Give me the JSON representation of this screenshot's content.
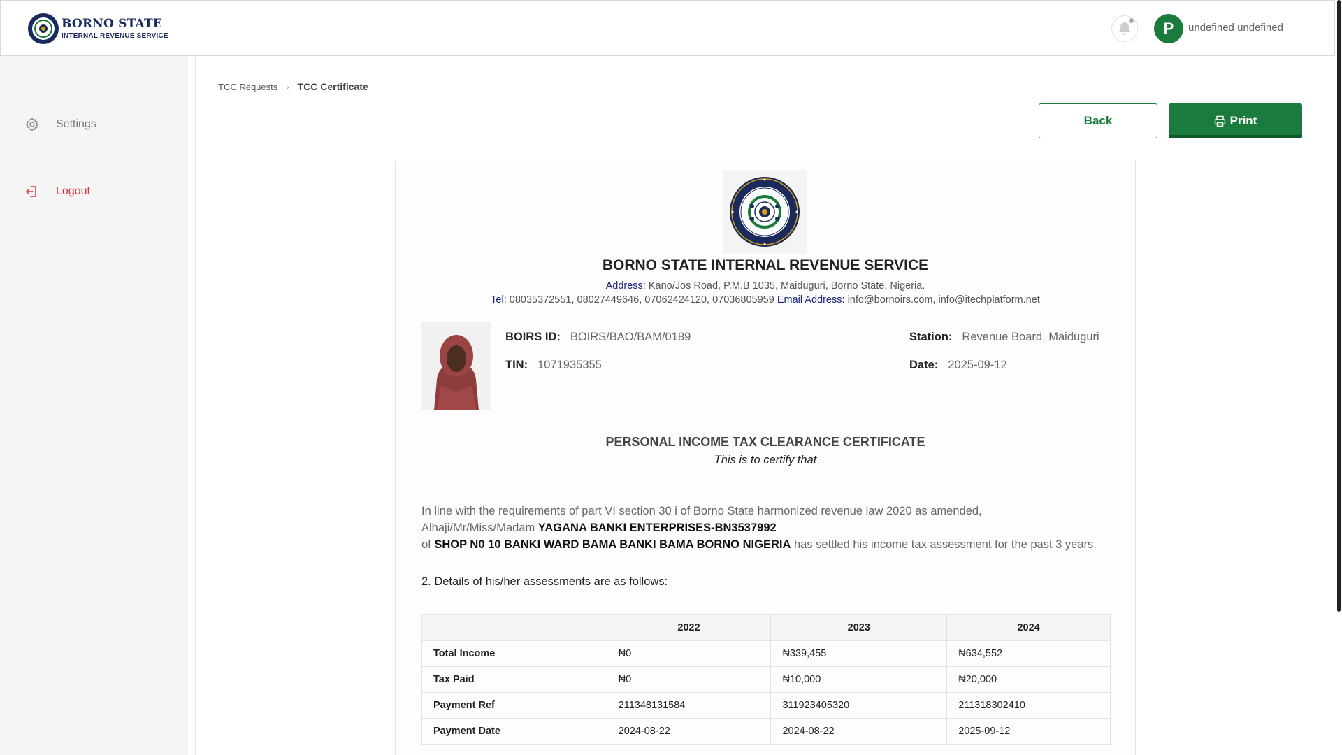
{
  "header": {
    "logo_title": "BORNO STATE",
    "logo_subtitle": "INTERNAL REVENUE SERVICE",
    "avatar_initial": "P",
    "user_name": "undefined undefined"
  },
  "sidebar": {
    "items": [
      {
        "label": "Settings",
        "icon": "gear-icon"
      },
      {
        "label": "Logout",
        "icon": "logout-icon"
      }
    ]
  },
  "breadcrumb": {
    "parent": "TCC Requests",
    "current": "TCC Certificate"
  },
  "actions": {
    "back_label": "Back",
    "print_label": "Print"
  },
  "certificate": {
    "org_name": "BORNO STATE INTERNAL REVENUE SERVICE",
    "address_label": "Address:",
    "address": "Kano/Jos Road, P.M.B 1035, Maiduguri, Borno State, Nigeria.",
    "tel_label": "Tel:",
    "tel": "08035372551, 08027449646, 07062424120, 07036805959",
    "email_label": "Email Address:",
    "email": "info@bornoirs.com, info@itechplatform.net",
    "boirs_label": "BOIRS ID:",
    "boirs_id": "BOIRS/BAO/BAM/0189",
    "tin_label": "TIN:",
    "tin": "1071935355",
    "station_label": "Station:",
    "station": "Revenue Board, Maiduguri",
    "date_label": "Date:",
    "date": "2025-09-12",
    "title": "PERSONAL INCOME TAX CLEARANCE CERTIFICATE",
    "subtitle": "This is to certify that",
    "para_intro": "In line with the requirements of part VI section 30 i of Borno State harmonized revenue law 2020 as amended,",
    "para_salutation": "Alhaji/Mr/Miss/Madam",
    "taxpayer_name": "YAGANA BANKI ENTERPRISES-BN3537992",
    "para_of": "of",
    "taxpayer_address": "SHOP N0 10 BANKI WARD BAMA BANKI BAMA BORNO NIGERIA",
    "para_end": "has settled his income tax assessment for the past 3 years.",
    "details_heading": "2. Details of his/her assessments are as follows:",
    "table": {
      "years": [
        "2022",
        "2023",
        "2024"
      ],
      "rows": [
        {
          "label": "Total Income",
          "values": [
            "₦0",
            "₦339,455",
            "₦634,552"
          ]
        },
        {
          "label": "Tax Paid",
          "values": [
            "₦0",
            "₦10,000",
            "₦20,000"
          ]
        },
        {
          "label": "Payment Ref",
          "values": [
            "211348131584",
            "311923405320",
            "211318302410"
          ]
        },
        {
          "label": "Payment Date",
          "values": [
            "2024-08-22",
            "2024-08-22",
            "2025-09-12"
          ]
        }
      ]
    }
  },
  "colors": {
    "brand_green": "#1b7b3c",
    "logout_red": "#d9363e",
    "navy": "#1a2a5c"
  }
}
